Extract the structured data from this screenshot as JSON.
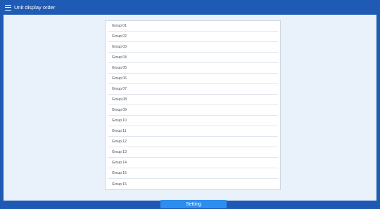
{
  "header": {
    "title": "Unit display order",
    "menu_icon": "hamburger-menu-icon"
  },
  "groups": [
    "Group 01",
    "Group 02",
    "Group 03",
    "Group 04",
    "Group 05",
    "Group 06",
    "Group 07",
    "Group 08",
    "Group 09",
    "Group 10",
    "Group 11",
    "Group 12",
    "Group 13",
    "Group 14",
    "Group 15",
    "Group 16"
  ],
  "footer": {
    "setting_label": "Setting"
  },
  "colors": {
    "header_bg": "#1f5bb5",
    "content_bg": "#e9f1fb",
    "button_bg": "#2e8ef0"
  }
}
